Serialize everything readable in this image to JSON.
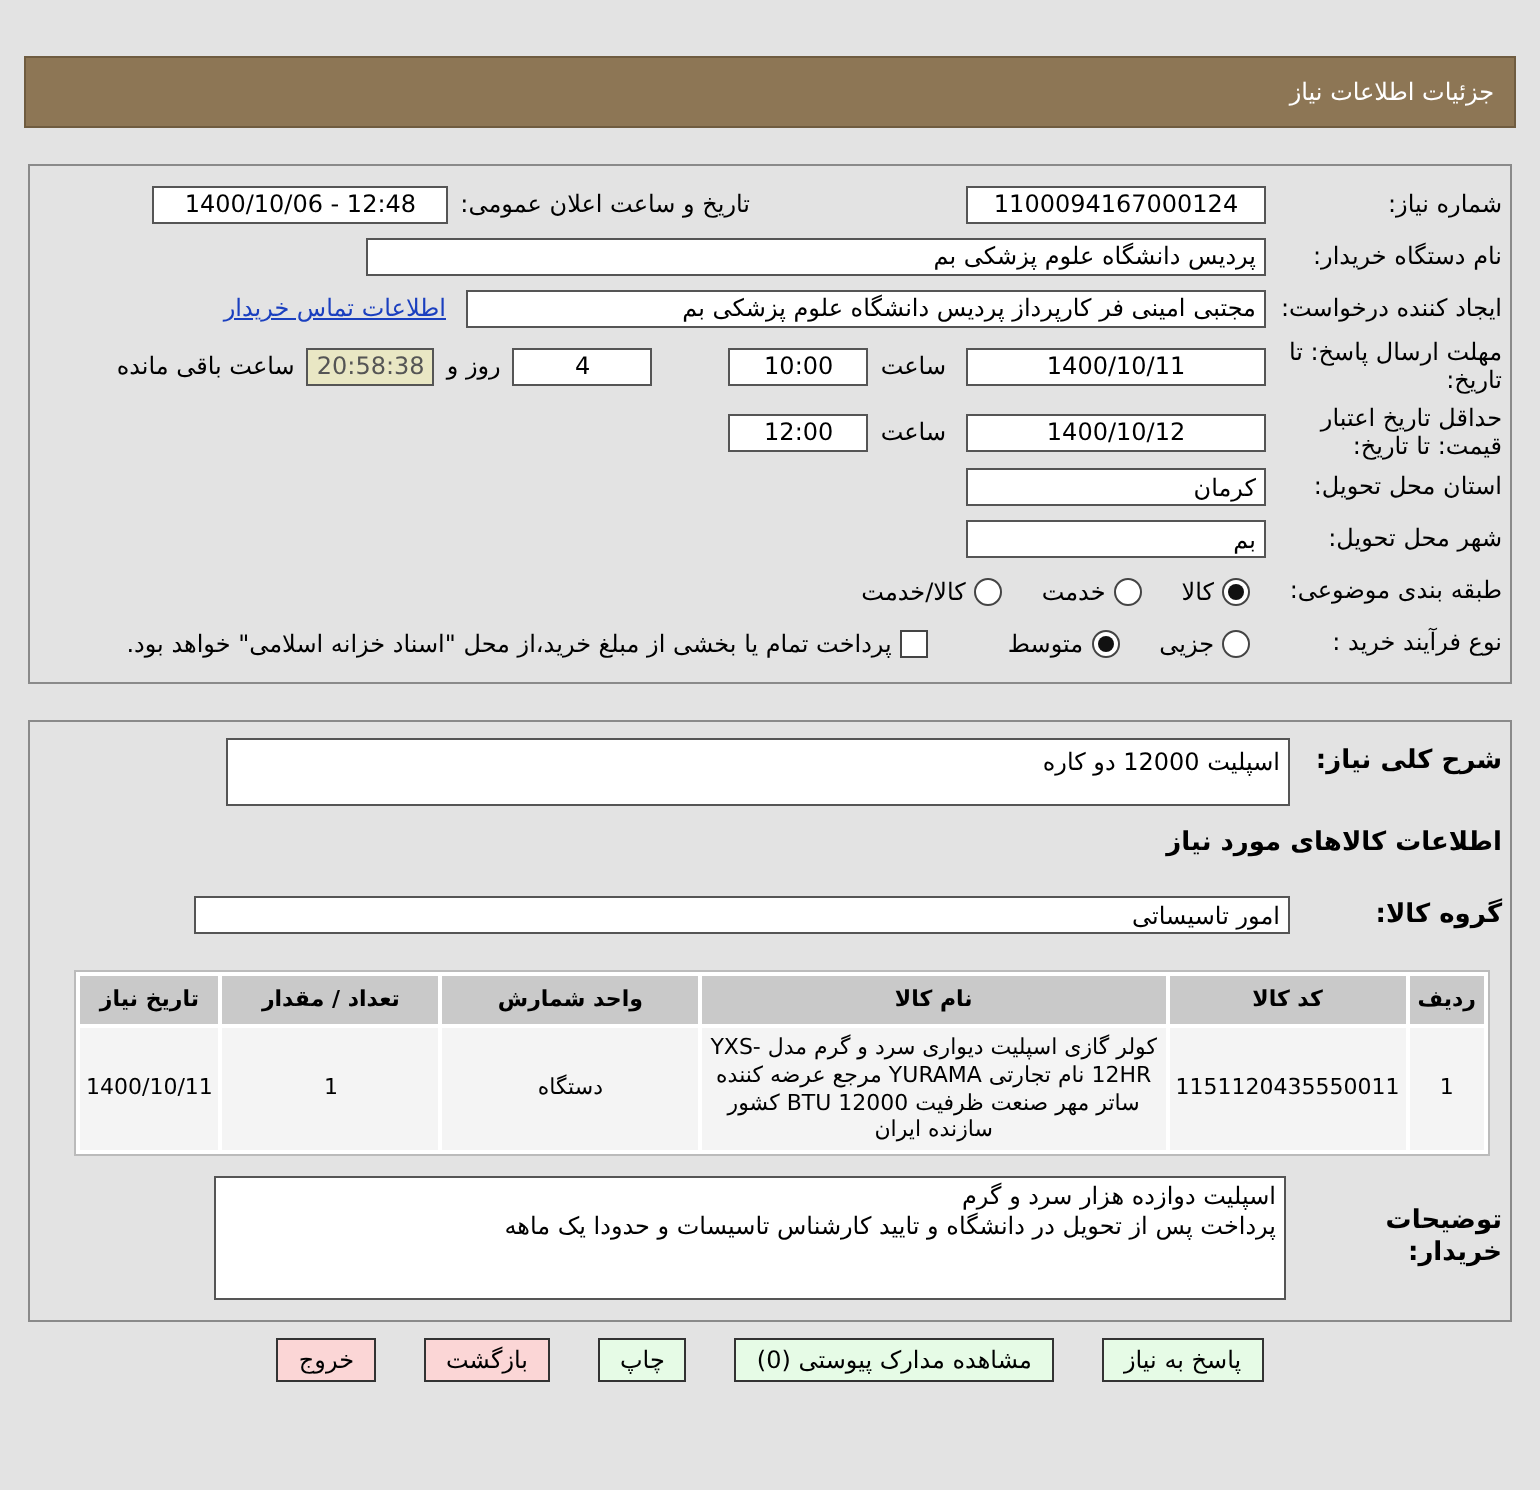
{
  "header": {
    "title": "جزئیات اطلاعات نیاز"
  },
  "need_info": {
    "need_number": {
      "label": "شماره نیاز:",
      "value": "1100094167000124"
    },
    "announce": {
      "label": "تاریخ و ساعت اعلان عمومی:",
      "value": "1400/10/06 - 12:48"
    },
    "buyer_org": {
      "label": "نام دستگاه خریدار:",
      "value": "پردیس دانشگاه علوم پزشکی بم"
    },
    "requester": {
      "label": "ایجاد کننده درخواست:",
      "value": "مجتبی امینی فر کارپرداز پردیس دانشگاه علوم پزشکی بم",
      "link": "اطلاعات تماس خریدار"
    },
    "deadline": {
      "label": "مهلت ارسال پاسخ: تا تاریخ:",
      "date": "1400/10/11",
      "time_label": "ساعت",
      "time": "10:00",
      "days": "4",
      "days_label": "روز و",
      "remaining": "20:58:38",
      "remaining_label": "ساعت باقی مانده"
    },
    "validity": {
      "label": "حداقل تاریخ اعتبار قیمت: تا تاریخ:",
      "date": "1400/10/12",
      "time_label": "ساعت",
      "time": "12:00"
    },
    "province": {
      "label": "استان محل تحویل:",
      "value": "کرمان"
    },
    "city": {
      "label": "شهر محل تحویل:",
      "value": "بم"
    },
    "category": {
      "label": "طبقه بندی موضوعی:",
      "options": [
        {
          "label": "کالا",
          "selected": true
        },
        {
          "label": "خدمت",
          "selected": false
        },
        {
          "label": "کالا/خدمت",
          "selected": false
        }
      ]
    },
    "process": {
      "label": "نوع فرآیند خرید :",
      "options": [
        {
          "label": "جزیی",
          "selected": false
        },
        {
          "label": "متوسط",
          "selected": true
        }
      ],
      "payment": {
        "checked": false,
        "text": "پرداخت تمام یا بخشی از مبلغ خرید،از محل \"اسناد خزانه اسلامی\" خواهد بود."
      }
    }
  },
  "goods": {
    "summary": {
      "label": "شرح کلی نیاز:",
      "value": "اسپلیت 12000 دو کاره"
    },
    "section_title": "اطلاعات کالاهای مورد نیاز",
    "group": {
      "label": "گروه کالا:",
      "value": "امور تاسیساتی"
    },
    "table": {
      "columns": [
        "ردیف",
        "کد کالا",
        "نام کالا",
        "واحد شمارش",
        "تعداد / مقدار",
        "تاریخ نیاز"
      ],
      "rows": [
        [
          "1",
          "1151120435550011",
          "کولر گازی اسپلیت دیواری سرد و گرم مدل YXS-12HR نام تجارتی YURAMA مرجع عرضه کننده ساتر مهر صنعت ظرفیت 12000 BTU کشور سازنده ایران",
          "دستگاه",
          "1",
          "1400/10/11"
        ]
      ]
    },
    "notes": {
      "label": "توضیحات خریدار:",
      "lines": [
        "اسپلیت دوازده هزار سرد و گرم",
        "پرداخت پس از تحویل در دانشگاه و تایید کارشناس تاسیسات و حدودا یک ماهه"
      ]
    }
  },
  "buttons": [
    {
      "label": "پاسخ به نیاز",
      "kind": "green"
    },
    {
      "label": "مشاهده مدارک پیوستی (0)",
      "kind": "green"
    },
    {
      "label": "چاپ",
      "kind": "green"
    },
    {
      "label": "بازگشت",
      "kind": "red"
    },
    {
      "label": "خروج",
      "kind": "red"
    }
  ]
}
